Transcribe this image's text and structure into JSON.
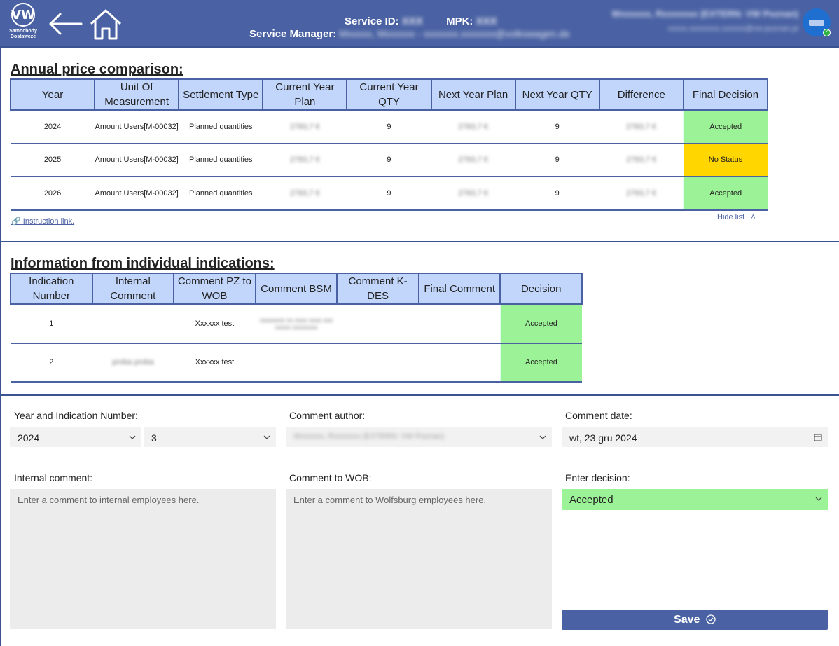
{
  "header": {
    "logo_text": "Samochody Dostawcze",
    "logo_glyph": "VW",
    "service_id_label": "Service ID:",
    "service_id_value": "XXX",
    "mpk_label": "MPK:",
    "mpk_value": "XXX",
    "service_manager_label": "Service Manager:",
    "service_manager_value": "Mxxxxx, Mxxxxxx - xxxxxxx.xxxxxxx@volkswagen.de",
    "user_name": "Wxxxxxx, Rxxxxxxx (EXTERN: VW Poznan)",
    "user_email": "xxxxx.xxxxxxxx.xxxxxx@vw-poznan.pl"
  },
  "annual": {
    "title": "Annual price comparison:",
    "columns": [
      "Year",
      "Unit Of Measurement",
      "Settlement Type",
      "Current Year Plan",
      "Current Year QTY",
      "Next Year Plan",
      "Next Year QTY",
      "Difference",
      "Final Decision"
    ],
    "rows": [
      {
        "year": "2024",
        "unit": "Amount Users[M-00032]",
        "settlement": "Planned quantities",
        "cur_plan": "2783,7 €",
        "cur_qty": "9",
        "next_plan": "2783,7 €",
        "next_qty": "9",
        "diff": "2783,7 €",
        "decision": "Accepted"
      },
      {
        "year": "2025",
        "unit": "Amount Users[M-00032]",
        "settlement": "Planned quantities",
        "cur_plan": "2783,7 €",
        "cur_qty": "9",
        "next_plan": "2783,7 €",
        "next_qty": "9",
        "diff": "2783,7 €",
        "decision": "No Status"
      },
      {
        "year": "2026",
        "unit": "Amount Users[M-00032]",
        "settlement": "Planned quantities",
        "cur_plan": "2783,7 €",
        "cur_qty": "9",
        "next_plan": "2783,7 €",
        "next_qty": "9",
        "diff": "2783,7 €",
        "decision": "Accepted"
      }
    ],
    "instruction_link": "Instruction link.",
    "hide_list": "Hide list"
  },
  "indications": {
    "title": "Information from individual indications:",
    "columns": [
      "Indication Number",
      "Internal Comment",
      "Comment PZ to WOB",
      "Comment BSM",
      "Comment K-DES",
      "Final Comment",
      "Decision"
    ],
    "rows": [
      {
        "number": "1",
        "internal": "",
        "pz_wob": "Xxxxxx test",
        "bsm": "xxxxxxxx xx xxxx xxxx xxx xxxxx xxxxxxxx",
        "kdes": "",
        "final": "",
        "decision": "Accepted"
      },
      {
        "number": "2",
        "internal": "proba proba",
        "pz_wob": "Xxxxxx test",
        "bsm": "",
        "kdes": "",
        "final": "",
        "decision": "Accepted"
      }
    ]
  },
  "form": {
    "year_label": "Year and Indication Number:",
    "year_value": "2024",
    "indication_value": "3",
    "author_label": "Comment author:",
    "author_value": "Wxxxxxx, Rxxxxxxx (EXTERN: VW Poznan)",
    "date_label": "Comment date:",
    "date_value": "wt, 23 gru 2024",
    "internal_label": "Internal comment:",
    "internal_placeholder": "Enter a comment to internal employees here.",
    "wob_label": "Comment to WOB:",
    "wob_placeholder": "Enter a comment to Wolfsburg employees here.",
    "decision_label": "Enter decision:",
    "decision_value": "Accepted",
    "save_label": "Save"
  },
  "colors": {
    "header": "#4a62a3",
    "accepted": "#9cf296",
    "no_status": "#ffd600",
    "th": "#c2d6fb"
  }
}
